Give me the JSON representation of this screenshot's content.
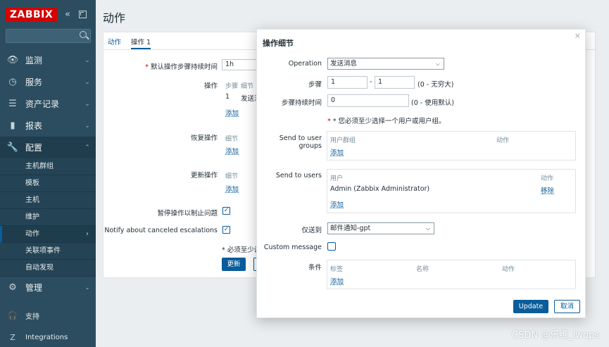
{
  "app": {
    "logo": "ZABBIX",
    "collapse_icon": "double-chevron-left-icon",
    "kiosk_icon": "kiosk-mode-icon"
  },
  "sidebar": {
    "menu": [
      {
        "label": "监测",
        "icon": "eye-icon"
      },
      {
        "label": "服务",
        "icon": "clock-icon"
      },
      {
        "label": "资产记录",
        "icon": "list-icon"
      },
      {
        "label": "报表",
        "icon": "bar-chart-icon"
      },
      {
        "label": "配置",
        "icon": "wrench-icon"
      }
    ],
    "submenu": [
      "主机群组",
      "模板",
      "主机",
      "维护",
      "动作",
      "关联项事件",
      "自动发现"
    ],
    "admin": {
      "label": "管理",
      "icon": "gear-icon"
    },
    "bottom": [
      {
        "label": "支持",
        "icon": "headset-icon"
      },
      {
        "label": "Integrations",
        "icon": "z-icon"
      }
    ]
  },
  "page": {
    "title": "动作"
  },
  "form": {
    "tabs": [
      "动作",
      "操作 1"
    ],
    "default_duration_label": "默认操作步骤持续时间",
    "default_duration_value": "1h",
    "operations_label": "操作",
    "operations_headers": [
      "步骤",
      "细节"
    ],
    "operations_row": [
      "1",
      "发送消"
    ],
    "add_label": "添加",
    "recovery_label": "恢复操作",
    "recovery_header": "细节",
    "update_ops_label": "更新操作",
    "update_ops_header": "细节",
    "pause_label": "暂停操作以制止问题",
    "notify_label": "Notify about canceled escalations",
    "required_note": "* 必须至少设",
    "update_button": "更新"
  },
  "dialog": {
    "title": "操作细节",
    "operation_label": "Operation",
    "operation_value": "发送消息",
    "steps_label": "步骤",
    "step_from": "1",
    "step_to": "1",
    "steps_hint": "(0 - 无穷大)",
    "duration_label": "步骤持续时间",
    "duration_value": "0",
    "duration_hint": "(0 - 使用默认)",
    "warning": "* 您必须至少选择一个用户或用户组。",
    "user_groups_label": "Send to user groups",
    "user_groups_headers": [
      "用户群组",
      "动作"
    ],
    "users_label": "Send to users",
    "users_headers": [
      "用户",
      "动作"
    ],
    "users_row": {
      "user": "Admin (Zabbix Administrator)",
      "action": "移除"
    },
    "add_label": "添加",
    "send_only_label": "仅送到",
    "send_only_value": "邮件通知-gpt",
    "custom_message_label": "Custom message",
    "conditions_label": "条件",
    "conditions_headers": [
      "标签",
      "名称",
      "动作"
    ],
    "update_button": "Update",
    "cancel_button": "取消"
  },
  "watermark": "CSDN @乐维_lwops"
}
